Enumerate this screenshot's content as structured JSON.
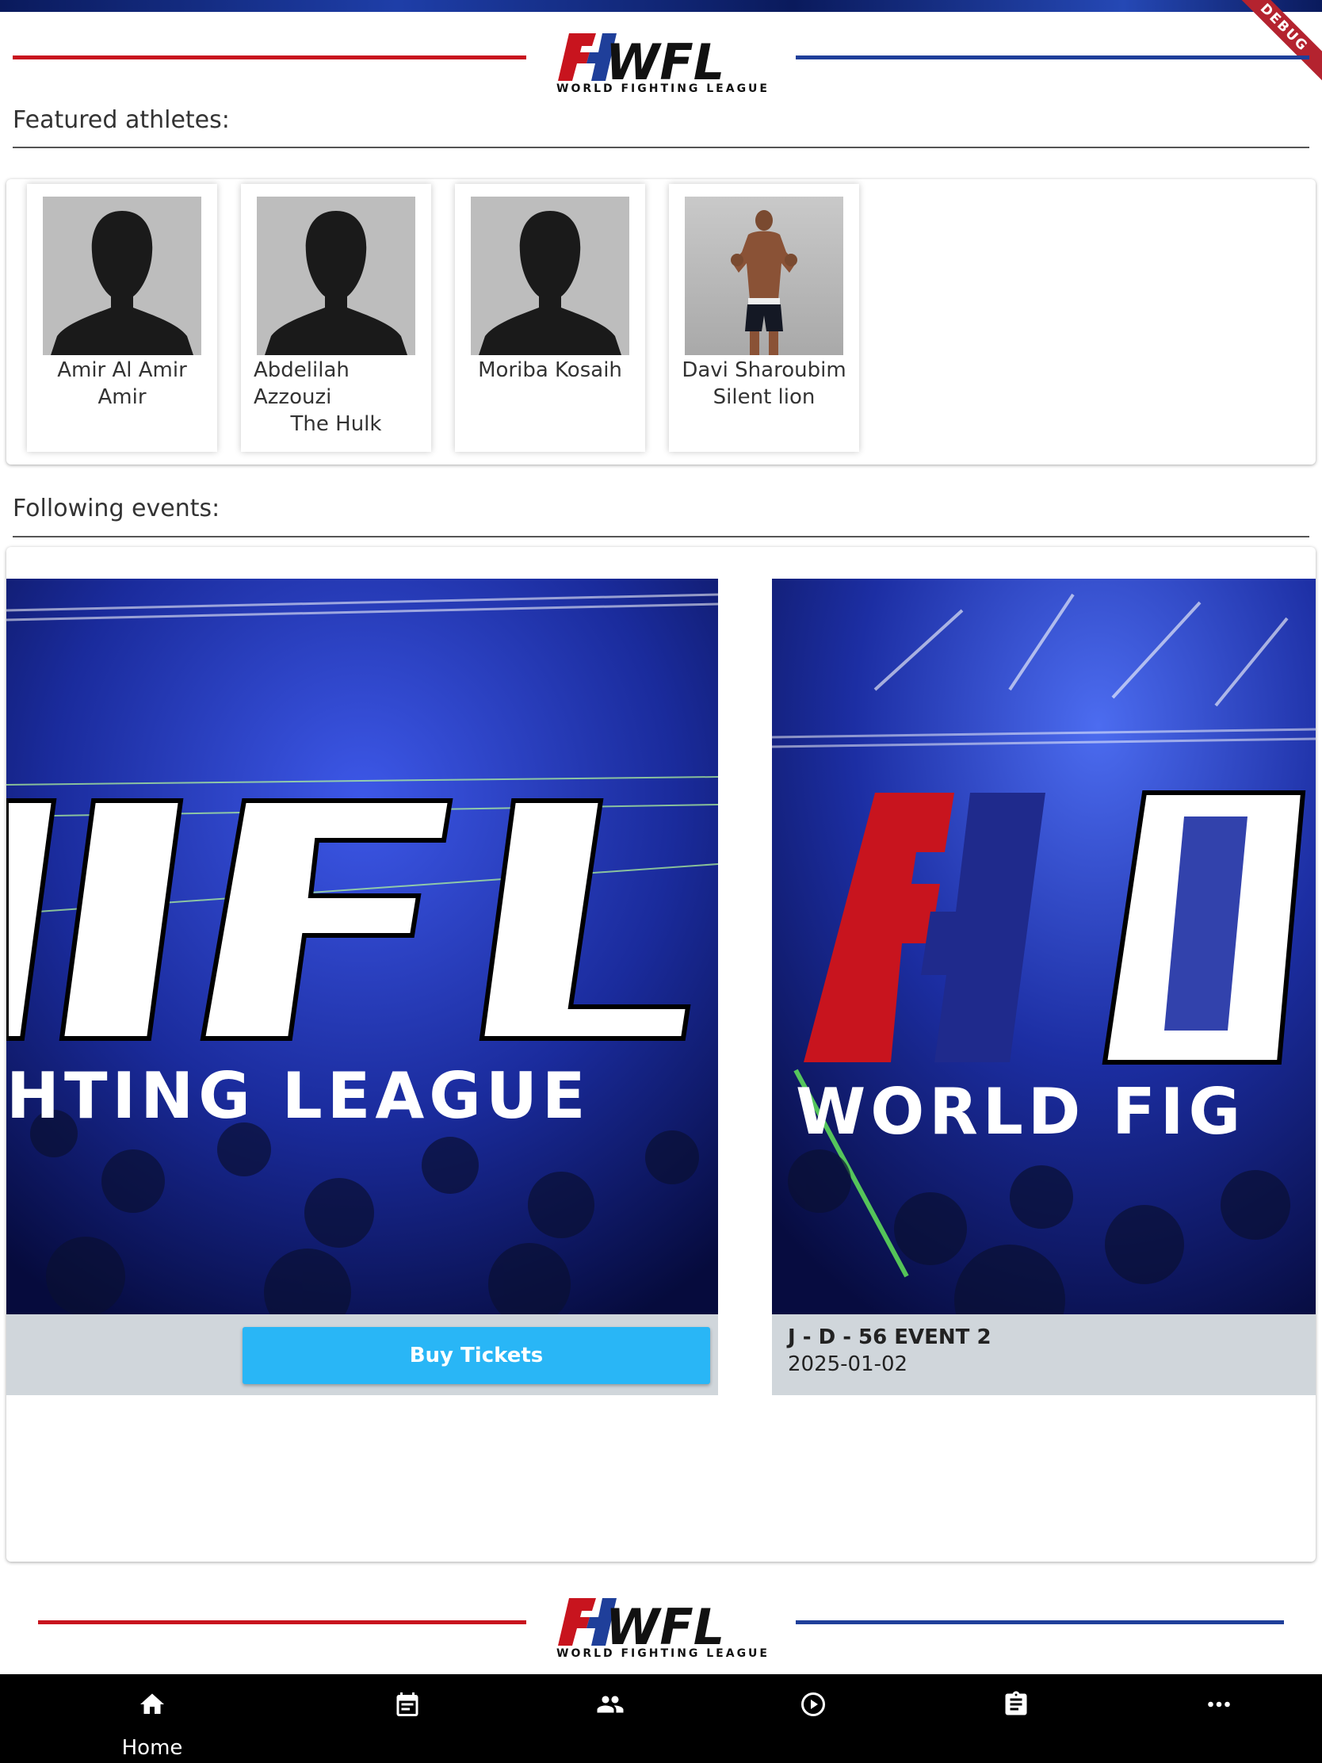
{
  "app": {
    "debug_banner": "DEBUG",
    "brand": {
      "wordmark": "WFL",
      "tagline": "WORLD FIGHTING LEAGUE",
      "red": "#c8141e",
      "blue": "#1f3f9a"
    }
  },
  "featured": {
    "title": "Featured athletes:",
    "athletes": [
      {
        "name": "Amir Al Amir",
        "nickname": "Amir",
        "photo": "silhouette-placeholder"
      },
      {
        "name": "Abdelilah Azzouzi",
        "nickname": "The Hulk",
        "photo": "silhouette-placeholder"
      },
      {
        "name": "Moriba Kosaih",
        "nickname": "",
        "photo": "silhouette-placeholder"
      },
      {
        "name": "Davi Sharoubim",
        "nickname": "Silent lion",
        "photo": "fighter-photo"
      }
    ]
  },
  "events": {
    "title": "Following events:",
    "items": [
      {
        "banner_text": "HTING LEAGUE",
        "buy_label": "Buy Tickets"
      },
      {
        "banner_text": "WORLD FIG",
        "name": "J - D - 56 EVENT 2",
        "date": "2025-01-02"
      }
    ]
  },
  "nav": {
    "items": [
      {
        "label": "Home",
        "icon": "home-icon"
      },
      {
        "label": "",
        "icon": "calendar-icon"
      },
      {
        "label": "",
        "icon": "people-icon"
      },
      {
        "label": "",
        "icon": "play-circle-icon"
      },
      {
        "label": "",
        "icon": "clipboard-icon"
      },
      {
        "label": "",
        "icon": "more-icon"
      }
    ]
  }
}
